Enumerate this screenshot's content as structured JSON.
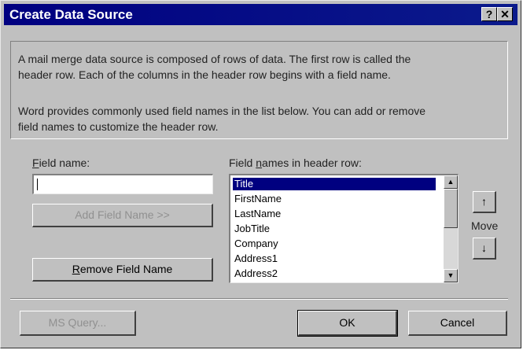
{
  "dialog": {
    "title": "Create Data Source",
    "help_button": "?",
    "close_button": "✕"
  },
  "info": {
    "line1": "A mail merge data source is composed of rows of data. The first row is called the",
    "line2": "header row. Each of the columns in the header row begins with a field name.",
    "line3": "Word provides commonly used field names in the list below. You can add or remove",
    "line4": "field names to customize the header row."
  },
  "field_name": {
    "label_underlined": "F",
    "label_rest": "ield name:",
    "value": ""
  },
  "header_list": {
    "label_before": "Field ",
    "label_underlined": "n",
    "label_after": "ames in header row:",
    "items": [
      "Title",
      "FirstName",
      "LastName",
      "JobTitle",
      "Company",
      "Address1",
      "Address2"
    ],
    "selected_index": 0,
    "scroll_up_glyph": "▲",
    "scroll_down_glyph": "▼"
  },
  "buttons": {
    "add_field_name": "Add Field Name >>",
    "remove_underlined": "R",
    "remove_rest": "emove Field Name",
    "ms_query": "MS Query...",
    "ok": "OK",
    "cancel": "Cancel"
  },
  "move": {
    "label": "Move",
    "up_glyph": "↑",
    "down_glyph": "↓"
  }
}
